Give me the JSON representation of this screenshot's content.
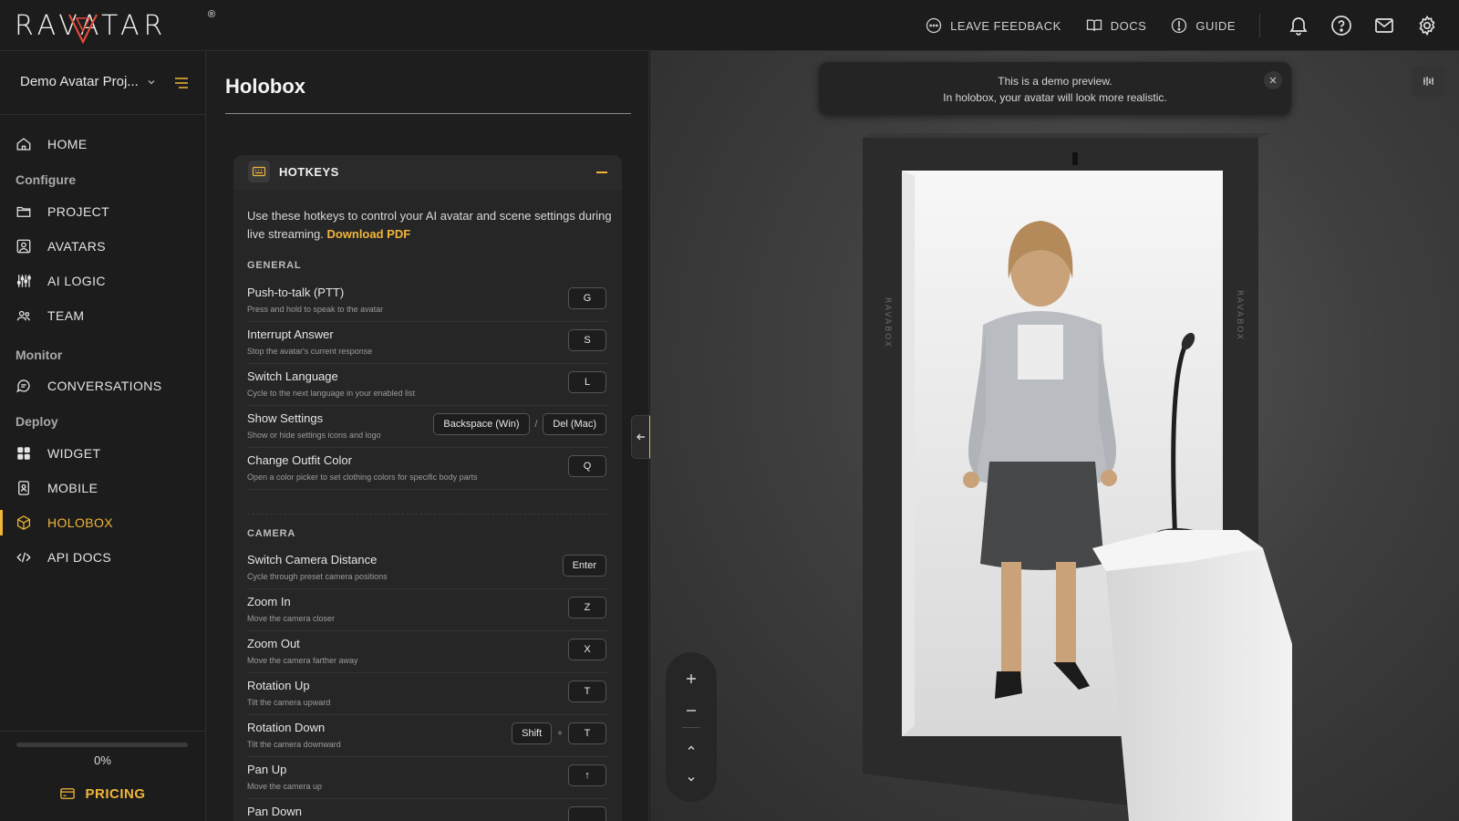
{
  "brand": {
    "logo_text": "RAVATAR",
    "reg": "®"
  },
  "topnav": {
    "feedback": "LEAVE FEEDBACK",
    "docs": "DOCS",
    "guide": "GUIDE"
  },
  "sidebar": {
    "project_name": "Demo Avatar Proj...",
    "home": "HOME",
    "sections": {
      "configure": "Configure",
      "monitor": "Monitor",
      "deploy": "Deploy"
    },
    "items": {
      "project": "PROJECT",
      "avatars": "AVATARS",
      "ai_logic": "AI LOGIC",
      "team": "TEAM",
      "conversations": "CONVERSATIONS",
      "widget": "WIDGET",
      "mobile": "MOBILE",
      "holobox": "HOLOBOX",
      "api_docs": "API DOCS"
    },
    "progress_value": 0,
    "progress_label": "0%",
    "pricing": "PRICING"
  },
  "page": {
    "title": "Holobox"
  },
  "hotkeys": {
    "title": "HOTKEYS",
    "description": "Use these hotkeys to control your AI avatar and scene settings during live streaming.",
    "download_link": "Download PDF",
    "general_label": "GENERAL",
    "camera_label": "CAMERA",
    "general": [
      {
        "name": "Push-to-talk (PTT)",
        "desc": "Press and hold to speak to the avatar",
        "keys": [
          "G"
        ]
      },
      {
        "name": "Interrupt Answer",
        "desc": "Stop the avatar's current response",
        "keys": [
          "S"
        ]
      },
      {
        "name": "Switch Language",
        "desc": "Cycle to the next language in your enabled list",
        "keys": [
          "L"
        ]
      },
      {
        "name": "Show Settings",
        "desc": "Show or hide settings icons and logo",
        "keys": [
          "Backspace (Win)",
          "Del (Mac)"
        ],
        "sep": "/"
      },
      {
        "name": "Change Outfit Color",
        "desc": "Open a color picker to set clothing colors for specific body parts",
        "keys": [
          "Q"
        ]
      }
    ],
    "camera": [
      {
        "name": "Switch Camera Distance",
        "desc": "Cycle through preset camera positions",
        "keys": [
          "Enter"
        ]
      },
      {
        "name": "Zoom In",
        "desc": "Move the camera closer",
        "keys": [
          "Z"
        ]
      },
      {
        "name": "Zoom Out",
        "desc": "Move the camera farther away",
        "keys": [
          "X"
        ]
      },
      {
        "name": "Rotation Up",
        "desc": "Tilt the camera upward",
        "keys": [
          "T"
        ]
      },
      {
        "name": "Rotation Down",
        "desc": "Tilt the camera downward",
        "keys": [
          "Shift",
          "T"
        ],
        "sep": "+"
      },
      {
        "name": "Pan Up",
        "desc": "Move the camera up",
        "keys": [
          "↑"
        ]
      },
      {
        "name": "Pan Down",
        "desc": "",
        "keys": [
          ""
        ]
      }
    ]
  },
  "preview": {
    "toast_line1": "This is a demo preview.",
    "toast_line2": "In holobox, your avatar will look more realistic.",
    "zoom_in": "+",
    "zoom_out": "−",
    "side_brand_text": "RAVABOX"
  },
  "colors": {
    "accent": "#f0b63a",
    "bg": "#1c1c1c",
    "panel": "#262626"
  }
}
